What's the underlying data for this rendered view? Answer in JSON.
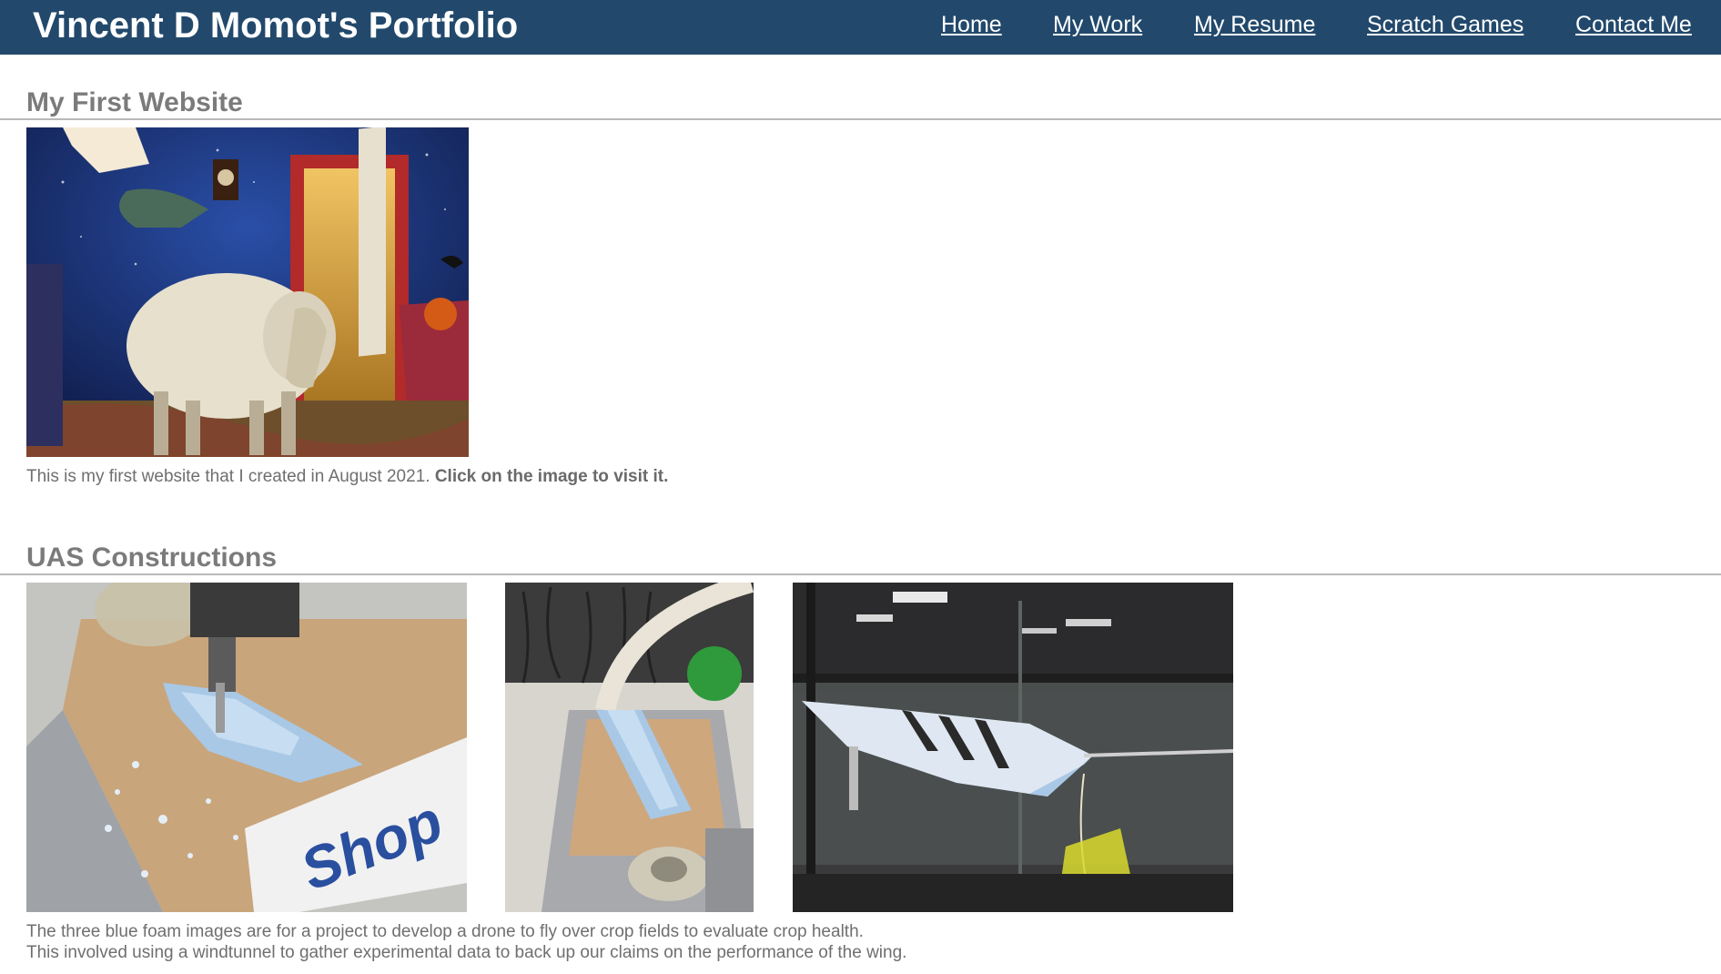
{
  "header": {
    "site_title": "Vincent D Momot's Portfolio",
    "nav": [
      "Home",
      "My Work",
      "My Resume",
      "Scratch Games",
      "Contact Me"
    ]
  },
  "sections": [
    {
      "title": "My First Website",
      "caption_text": "This is my first website that I created in August 2021.",
      "caption_strong": "Click on the image to visit it."
    },
    {
      "title": "UAS Constructions",
      "caption_lines": [
        "The three blue foam images are for a project to develop a drone to fly over crop fields to evaluate crop health.",
        "This involved using a windtunnel to gather experimental data to back up our claims on the performance of the wing."
      ]
    }
  ],
  "colors": {
    "header_bg": "#22496c",
    "text": "#6f6f6f",
    "rule": "#b9b9b9"
  }
}
